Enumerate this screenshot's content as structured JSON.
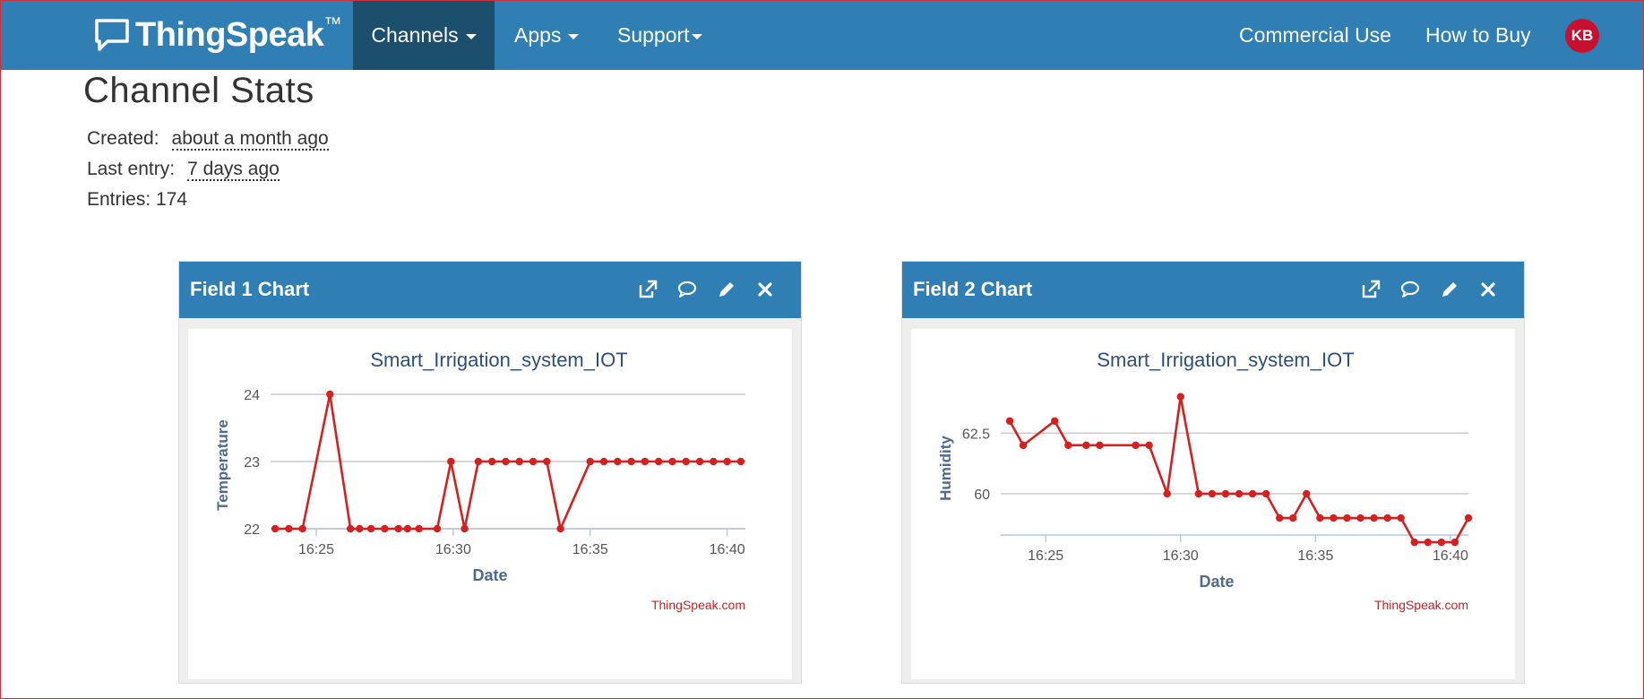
{
  "navbar": {
    "brand": "ThingSpeak",
    "brand_tm": "™",
    "items": [
      {
        "label": "Channels",
        "active": true
      },
      {
        "label": "Apps"
      },
      {
        "label": "Support"
      }
    ],
    "right_items": [
      {
        "label": "Commercial Use"
      },
      {
        "label": "How to Buy"
      }
    ],
    "avatar": "KB"
  },
  "stats": {
    "title": "Channel Stats",
    "created_label": "Created:",
    "created_value": "about a month ago",
    "last_entry_label": "Last entry:",
    "last_entry_value": "7 days ago",
    "entries_text": "Entries: 174"
  },
  "panels": [
    {
      "title": "Field 1 Chart",
      "icons": [
        "external-link-icon",
        "comment-icon",
        "pencil-icon",
        "close-icon"
      ]
    },
    {
      "title": "Field 2 Chart",
      "icons": [
        "external-link-icon",
        "comment-icon",
        "pencil-icon",
        "close-icon"
      ]
    }
  ],
  "chart_data": [
    {
      "type": "line",
      "title": "Smart_Irrigation_system_IOT",
      "xlabel": "Date",
      "ylabel": "Temperature",
      "credit": "ThingSpeak.com",
      "color": "#d62020",
      "xlim": [
        "16:23:20",
        "16:40:40"
      ],
      "ylim": [
        22,
        24
      ],
      "yticks": [
        "22",
        "23",
        "24"
      ],
      "xticks": [
        "16:25",
        "16:30",
        "16:35",
        "16:40"
      ],
      "x": [
        "16:23:30",
        "16:24:00",
        "16:24:30",
        "16:25:30",
        "16:26:15",
        "16:26:35",
        "16:27:00",
        "16:27:30",
        "16:28:00",
        "16:28:20",
        "16:28:45",
        "16:29:25",
        "16:29:55",
        "16:30:25",
        "16:30:55",
        "16:31:25",
        "16:31:55",
        "16:32:25",
        "16:32:55",
        "16:33:25",
        "16:33:55",
        "16:35:00",
        "16:35:30",
        "16:36:00",
        "16:36:30",
        "16:37:00",
        "16:37:30",
        "16:38:00",
        "16:38:30",
        "16:39:00",
        "16:39:30",
        "16:40:00",
        "16:40:30"
      ],
      "y": [
        22,
        22,
        22,
        24,
        22,
        22,
        22,
        22,
        22,
        22,
        22,
        22,
        23,
        22,
        23,
        23,
        23,
        23,
        23,
        23,
        22,
        23,
        23,
        23,
        23,
        23,
        23,
        23,
        23,
        23,
        23,
        23,
        23
      ]
    },
    {
      "type": "line",
      "title": "Smart_Irrigation_system_IOT",
      "xlabel": "Date",
      "ylabel": "Humidity",
      "credit": "ThingSpeak.com",
      "color": "#d62020",
      "xlim": [
        "16:23:20",
        "16:40:40"
      ],
      "ylim": [
        58.3,
        64.1
      ],
      "yticks": [
        "60",
        "62.5"
      ],
      "xticks": [
        "16:25",
        "16:30",
        "16:35",
        "16:40"
      ],
      "x": [
        "16:23:40",
        "16:24:10",
        "16:25:20",
        "16:25:50",
        "16:26:30",
        "16:27:00",
        "16:28:20",
        "16:28:50",
        "16:29:30",
        "16:30:00",
        "16:30:40",
        "16:31:10",
        "16:31:40",
        "16:32:10",
        "16:32:40",
        "16:33:10",
        "16:33:40",
        "16:34:10",
        "16:34:40",
        "16:35:10",
        "16:35:40",
        "16:36:10",
        "16:36:40",
        "16:37:10",
        "16:37:40",
        "16:38:10",
        "16:38:40",
        "16:39:10",
        "16:39:40",
        "16:40:10",
        "16:40:40"
      ],
      "y": [
        63,
        62,
        63,
        62,
        62,
        62,
        62,
        62,
        60,
        64,
        60,
        60,
        60,
        60,
        60,
        60,
        59,
        59,
        60,
        59,
        59,
        59,
        59,
        59,
        59,
        59,
        58,
        58,
        58,
        58,
        59
      ]
    }
  ]
}
